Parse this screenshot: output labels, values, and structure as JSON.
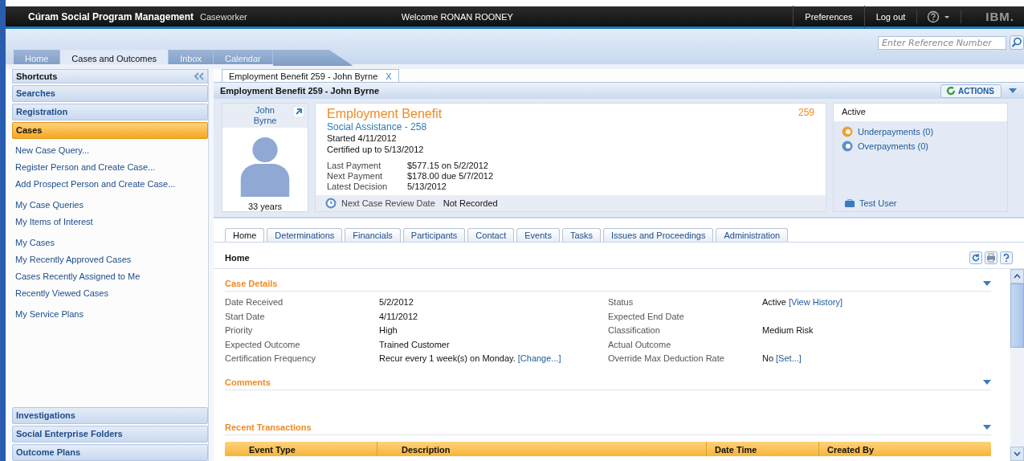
{
  "header": {
    "product": "Cúram Social Program Management",
    "role": "Caseworker",
    "welcome": "Welcome RONAN ROONEY",
    "links": [
      "Preferences",
      "Log out"
    ],
    "logo": "IBM."
  },
  "search": {
    "placeholder": "Enter Reference Number"
  },
  "tabs": [
    {
      "label": "Home",
      "selected": false
    },
    {
      "label": "Cases and Outcomes",
      "selected": true
    },
    {
      "label": "Inbox",
      "selected": false
    },
    {
      "label": "Calendar",
      "selected": false
    }
  ],
  "sidebar": {
    "title": "Shortcuts",
    "sections": [
      {
        "label": "Searches",
        "selected": false
      },
      {
        "label": "Registration",
        "selected": false
      },
      {
        "label": "Cases",
        "selected": true,
        "link_groups": [
          [
            "New Case Query...",
            "Register Person and Create Case...",
            "Add Prospect Person and Create Case..."
          ],
          [
            "My Case Queries",
            "My Items of Interest"
          ],
          [
            "My Cases",
            "My Recently Approved Cases",
            "Cases Recently Assigned to Me",
            "Recently Viewed Cases"
          ],
          [
            "My Service Plans"
          ]
        ]
      },
      {
        "label": "Investigations",
        "selected": false
      },
      {
        "label": "Social Enterprise Folders",
        "selected": false
      },
      {
        "label": "Outcome Plans",
        "selected": false
      }
    ]
  },
  "open_tab": {
    "label": "Employment Benefit 259 - John Byrne",
    "close": "X"
  },
  "page_title": "Employment Benefit 259 - John Byrne",
  "actions": "ACTIONS",
  "person": {
    "name": "John Byrne",
    "age": "33 years"
  },
  "case": {
    "title": "Employment Benefit",
    "number": "259",
    "subtitle": "Social Assistance - 258",
    "lines": [
      "Started 4/11/2012",
      "Certified up to 5/13/2012"
    ],
    "payments": [
      {
        "label": "Last Payment",
        "value": "$577.15 on 5/2/2012"
      },
      {
        "label": "Next Payment",
        "value": "$178.00 due 5/7/2012"
      },
      {
        "label": "Latest Decision",
        "value": "5/13/2012"
      }
    ],
    "review": {
      "label": "Next Case Review Date",
      "value": "Not Recorded"
    }
  },
  "status_panel": {
    "status": "Active",
    "links": [
      {
        "label": "Underpayments (0)",
        "kind": "under"
      },
      {
        "label": "Overpayments (0)",
        "kind": "over"
      }
    ],
    "user": "Test User"
  },
  "case_tabs": [
    {
      "label": "Home",
      "selected": true
    },
    {
      "label": "Determinations",
      "selected": false
    },
    {
      "label": "Financials",
      "selected": false
    },
    {
      "label": "Participants",
      "selected": false
    },
    {
      "label": "Contact",
      "selected": false
    },
    {
      "label": "Events",
      "selected": false
    },
    {
      "label": "Tasks",
      "selected": false
    },
    {
      "label": "Issues and Proceedings",
      "selected": false
    },
    {
      "label": "Administration",
      "selected": false
    }
  ],
  "content_title": "Home",
  "case_details": {
    "title": "Case Details",
    "left": [
      {
        "label": "Date Received",
        "value": "5/2/2012"
      },
      {
        "label": "Start Date",
        "value": "4/11/2012"
      },
      {
        "label": "Priority",
        "value": "High"
      },
      {
        "label": "Expected Outcome",
        "value": "Trained Customer"
      },
      {
        "label": "Certification Frequency",
        "value": "Recur every 1 week(s) on Monday.",
        "link": "[Change...]"
      }
    ],
    "right": [
      {
        "label": "Status",
        "value": "Active",
        "link": "[View History]"
      },
      {
        "label": "Expected End Date"
      },
      {
        "label": "Classification",
        "value": "Medium Risk"
      },
      {
        "label": "Actual Outcome"
      },
      {
        "label": "Override Max Deduction Rate",
        "value": "No",
        "link": "[Set...]"
      }
    ]
  },
  "comments": {
    "title": "Comments"
  },
  "transactions": {
    "title": "Recent Transactions",
    "columns": [
      "Event Type",
      "Description",
      "Date Time",
      "Created By"
    ]
  }
}
